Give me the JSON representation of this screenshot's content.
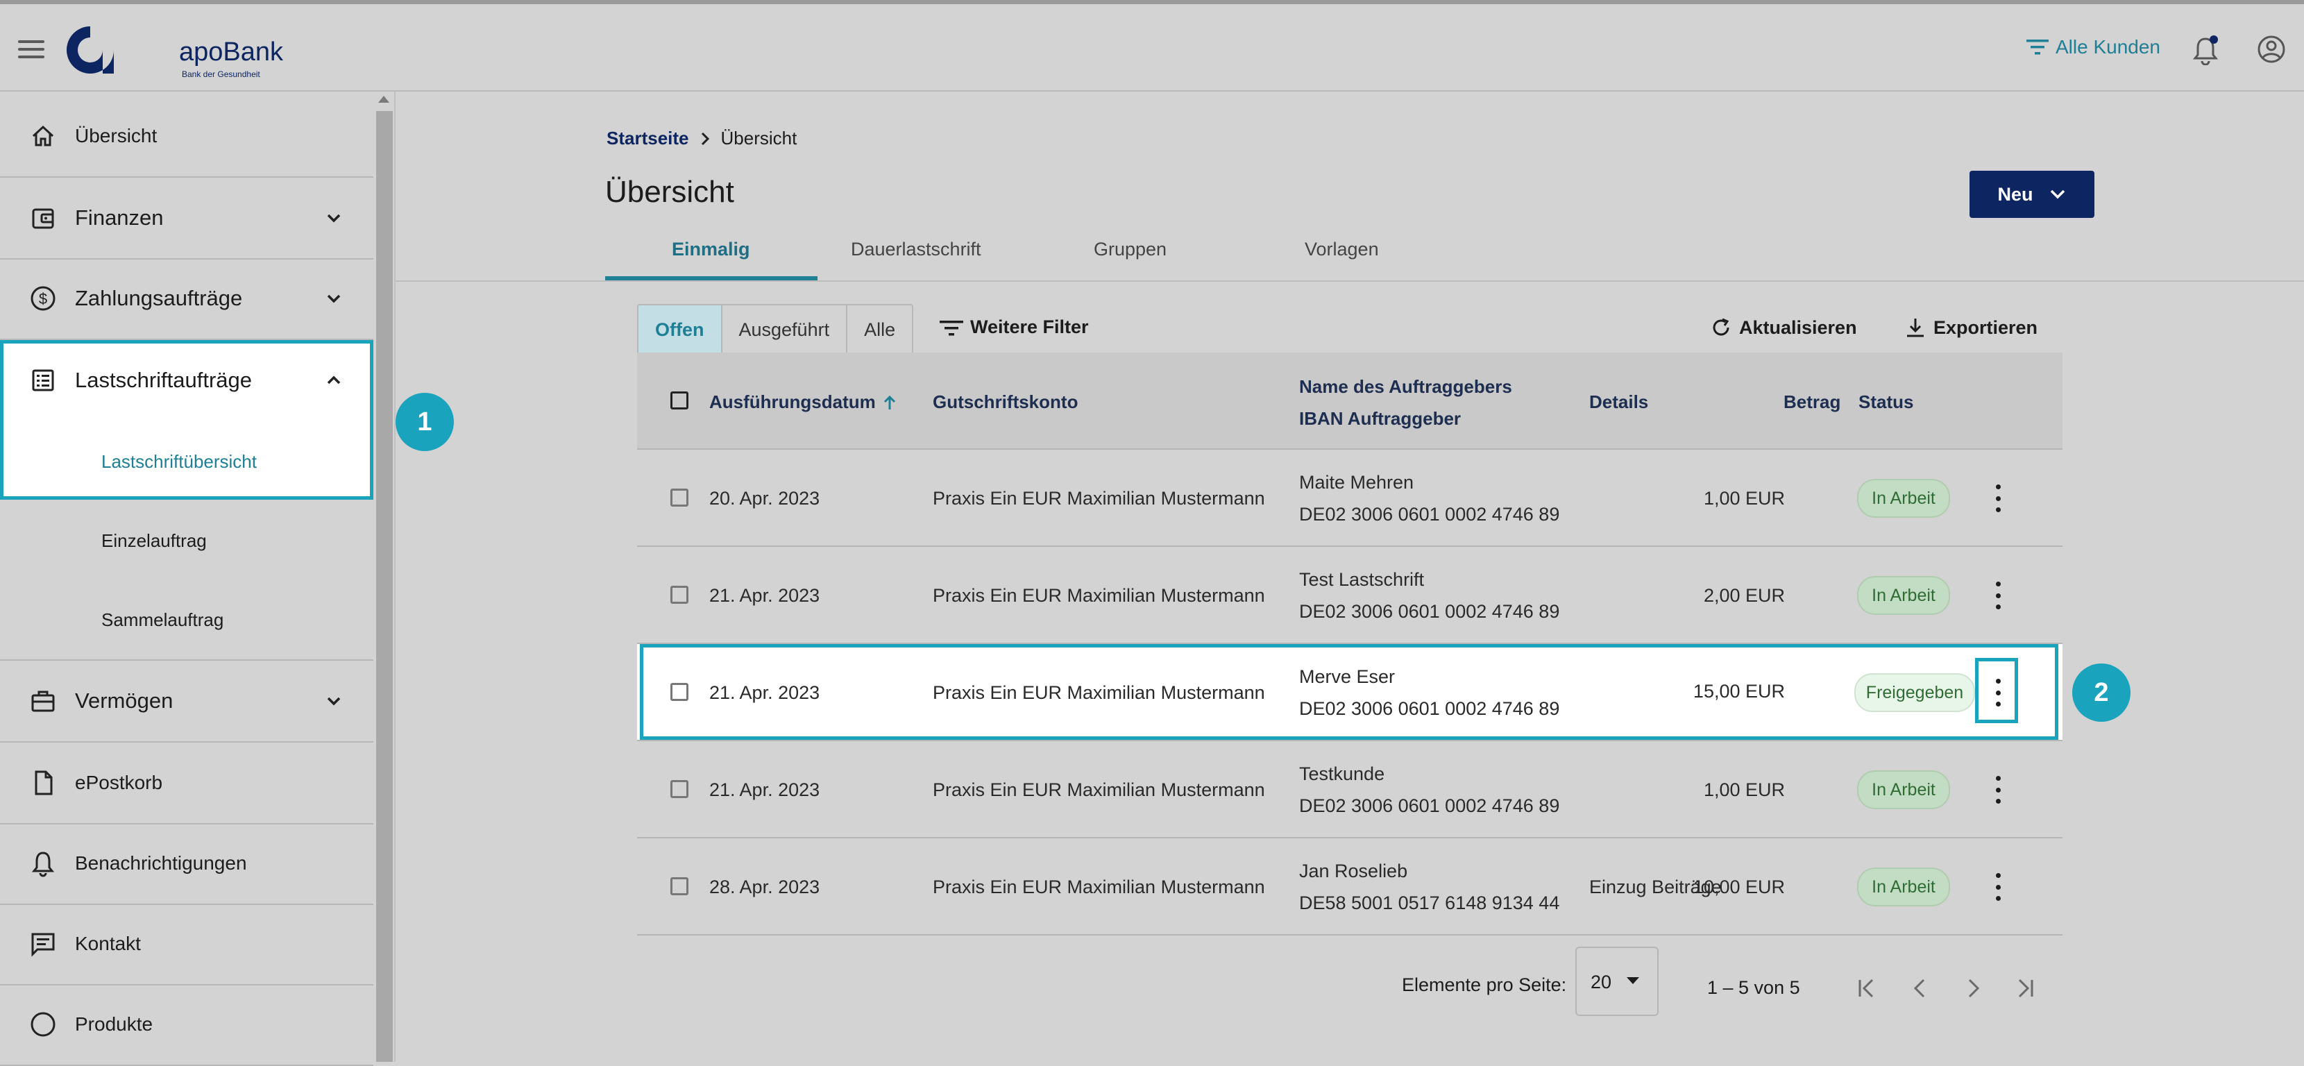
{
  "header": {
    "brand": "apoBank",
    "brand_tagline": "Bank der Gesundheit",
    "customers_filter": "Alle Kunden"
  },
  "sidebar": {
    "items": [
      {
        "label": "Übersicht",
        "icon": "home-icon"
      },
      {
        "label": "Finanzen",
        "icon": "wallet-icon"
      },
      {
        "label": "Zahlungsaufträge",
        "icon": "dollar-circle-icon"
      },
      {
        "label": "Lastschriftaufträge",
        "icon": "list-icon"
      },
      {
        "label": "Vermögen",
        "icon": "briefcase-icon"
      },
      {
        "label": "ePostkorb",
        "icon": "document-icon"
      },
      {
        "label": "Benachrichtigungen",
        "icon": "bell-icon"
      },
      {
        "label": "Kontakt",
        "icon": "chat-icon"
      },
      {
        "label": "Produkte",
        "icon": "circle-icon"
      }
    ],
    "subitems": [
      "Lastschriftübersicht",
      "Einzelauftrag",
      "Sammelauftrag"
    ]
  },
  "callouts": {
    "one": "1",
    "two": "2"
  },
  "breadcrumb": {
    "home": "Startseite",
    "current": "Übersicht"
  },
  "page_title": "Übersicht",
  "new_button": "Neu",
  "tabs": [
    "Einmalig",
    "Dauerlastschrift",
    "Gruppen",
    "Vorlagen"
  ],
  "filters": {
    "segments": [
      "Offen",
      "Ausgeführt",
      "Alle"
    ],
    "more_filters": "Weitere Filter",
    "refresh": "Aktualisieren",
    "export": "Exportieren"
  },
  "table": {
    "headers": {
      "date": "Ausführungsdatum",
      "account": "Gutschriftskonto",
      "name": "Name des Auftraggebers",
      "iban": "IBAN Auftraggeber",
      "details": "Details",
      "amount": "Betrag",
      "status": "Status"
    },
    "rows": [
      {
        "date": "20. Apr. 2023",
        "account": "Praxis Ein EUR Maximilian Mustermann",
        "name": "Maite Mehren",
        "iban": "DE02 3006 0601 0002 4746 89",
        "details": "",
        "amount": "1,00 EUR",
        "status": "In Arbeit"
      },
      {
        "date": "21. Apr. 2023",
        "account": "Praxis Ein EUR Maximilian Mustermann",
        "name": "Test Lastschrift",
        "iban": "DE02 3006 0601 0002 4746 89",
        "details": "",
        "amount": "2,00 EUR",
        "status": "In Arbeit"
      },
      {
        "date": "21. Apr. 2023",
        "account": "Praxis Ein EUR Maximilian Mustermann",
        "name": "Merve Eser",
        "iban": "DE02 3006 0601 0002 4746 89",
        "details": "",
        "amount": "15,00 EUR",
        "status": "Freigegeben"
      },
      {
        "date": "21. Apr. 2023",
        "account": "Praxis Ein EUR Maximilian Mustermann",
        "name": "Testkunde",
        "iban": "DE02 3006 0601 0002 4746 89",
        "details": "",
        "amount": "1,00 EUR",
        "status": "In Arbeit"
      },
      {
        "date": "28. Apr. 2023",
        "account": "Praxis Ein EUR Maximilian Mustermann",
        "name": "Jan Roselieb",
        "iban": "DE58 5001 0517 6148 9134 44",
        "details": "Einzug Beiträge",
        "amount": "10,00 EUR",
        "status": "In Arbeit"
      }
    ]
  },
  "pagination": {
    "label": "Elemente pro Seite:",
    "page_size": "20",
    "range": "1 – 5 von 5"
  },
  "colors": {
    "accent": "#1aa3bd",
    "brand": "#0d2560",
    "teal": "#1e7f95"
  }
}
